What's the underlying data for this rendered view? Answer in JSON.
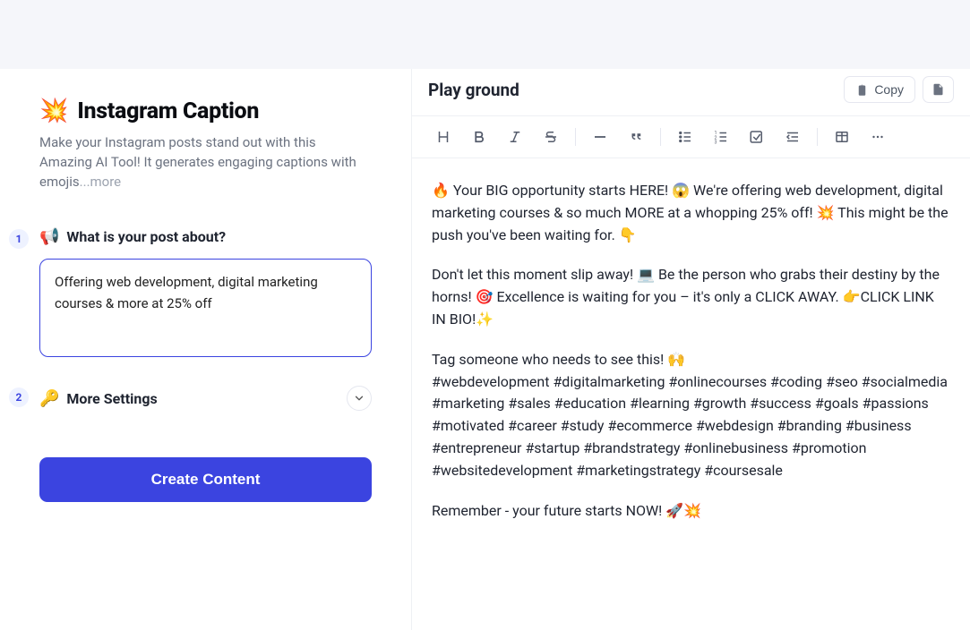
{
  "left": {
    "title_emoji": "💥",
    "title": "Instagram Caption",
    "subtitle_pre": "Make your Instagram posts stand out with this Amazing AI Tool! It generates engaging captions with emojis",
    "subtitle_ellipsis": "...",
    "subtitle_more": "more",
    "step1_num": "1",
    "step1_emoji": "📢",
    "step1_label": "What is your post about?",
    "step1_value": "Offering web development, digital marketing courses & more at 25% off",
    "step2_num": "2",
    "step2_emoji": "🔑",
    "step2_label": "More Settings",
    "create_button": "Create Content"
  },
  "right": {
    "header": {
      "title": "Play ground",
      "copy_label": "Copy"
    },
    "content": {
      "p1": "🔥 Your BIG opportunity starts HERE! 😱 We're offering web development, digital marketing courses & so much MORE at a whopping 25% off! 💥 This might be the push you've been waiting for. 👇",
      "p2": "Don't let this moment slip away! 💻 Be the person who grabs their destiny by the horns! 🎯 Excellence is waiting for you – it's only a CLICK AWAY. 👉CLICK LINK IN BIO!✨",
      "p3": "Tag someone who needs to see this! 🙌\n#webdevelopment #digitalmarketing #onlinecourses #coding #seo #socialmedia #marketing #sales #education #learning #growth #success #goals #passions #motivated #career #study #ecommerce #webdesign #branding #business #entrepreneur #startup #brandstrategy #onlinebusiness #promotion #websitedevelopment #marketingstrategy #coursesale",
      "p4": "Remember - your future starts NOW! 🚀💥"
    }
  }
}
